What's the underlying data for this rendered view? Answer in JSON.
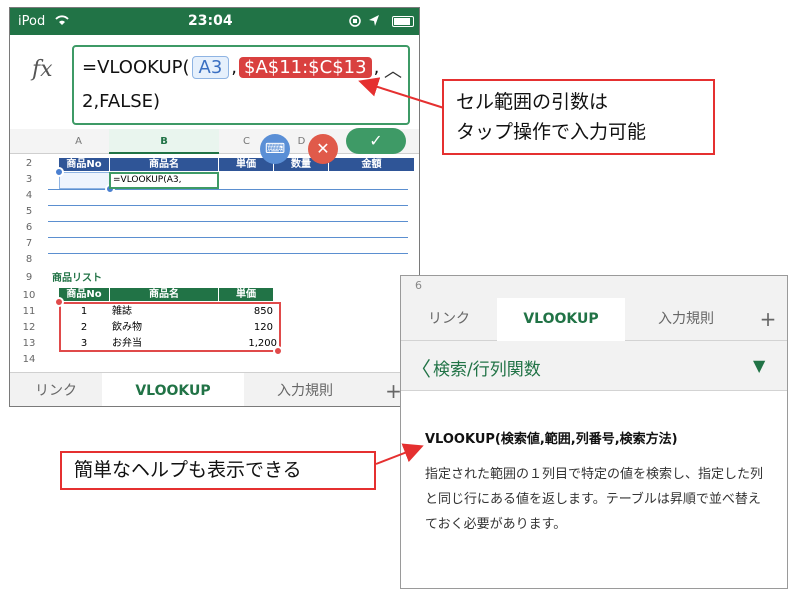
{
  "status_bar": {
    "carrier": "iPod",
    "time": "23:04"
  },
  "formula": {
    "fx_label": "fx",
    "prefix": "=VLOOKUP(",
    "ref_a3": "A3",
    "sep1": ",",
    "ref_range": "$A$11:$C$13",
    "sep2": ",",
    "line2": "2,FALSE)",
    "collapse_glyph": "︿"
  },
  "sheet": {
    "columns": [
      "A",
      "B",
      "C",
      "D"
    ],
    "rows": [
      "2",
      "3",
      "4",
      "5",
      "6",
      "7",
      "8",
      "9",
      "10",
      "11",
      "12",
      "13",
      "14"
    ],
    "row2_headers": [
      "商品No",
      "商品名",
      "単価",
      "数量",
      "金額"
    ],
    "b3_text": "=VLOOKUP(A3,",
    "list_title": "商品リスト",
    "list_headers": [
      "商品No",
      "商品名",
      "単価"
    ],
    "list_rows": [
      {
        "no": "1",
        "name": "雑誌",
        "price": "850"
      },
      {
        "no": "2",
        "name": "飲み物",
        "price": "120"
      },
      {
        "no": "3",
        "name": "お弁当",
        "price": "1,200"
      }
    ]
  },
  "buttons": {
    "cancel_glyph": "✕",
    "confirm_glyph": "✓",
    "keyboard_glyph": "⌨"
  },
  "tabs": {
    "link": "リンク",
    "vlookup": "VLOOKUP",
    "input_rules": "入力規則",
    "add": "+"
  },
  "help": {
    "tab_number": "6",
    "back_glyph": "〈",
    "category": "検索/行列関数",
    "dropdown_glyph": "▼",
    "title": "VLOOKUP(検索値,範囲,列番号,検索方法)",
    "body": "指定された範囲の１列目で特定の値を検索し、指定した列と同じ行にある値を返します。テーブルは昇順で並べ替えておく必要があります。"
  },
  "callouts": {
    "range_line1": "セル範囲の引数は",
    "range_line2": "タップ操作で入力可能",
    "help_text": "簡単なヘルプも表示できる"
  },
  "colors": {
    "excel_green": "#217346",
    "callout_red": "#e53030",
    "header_blue": "#2f5597",
    "ref_blue": "#3a6fc2"
  }
}
